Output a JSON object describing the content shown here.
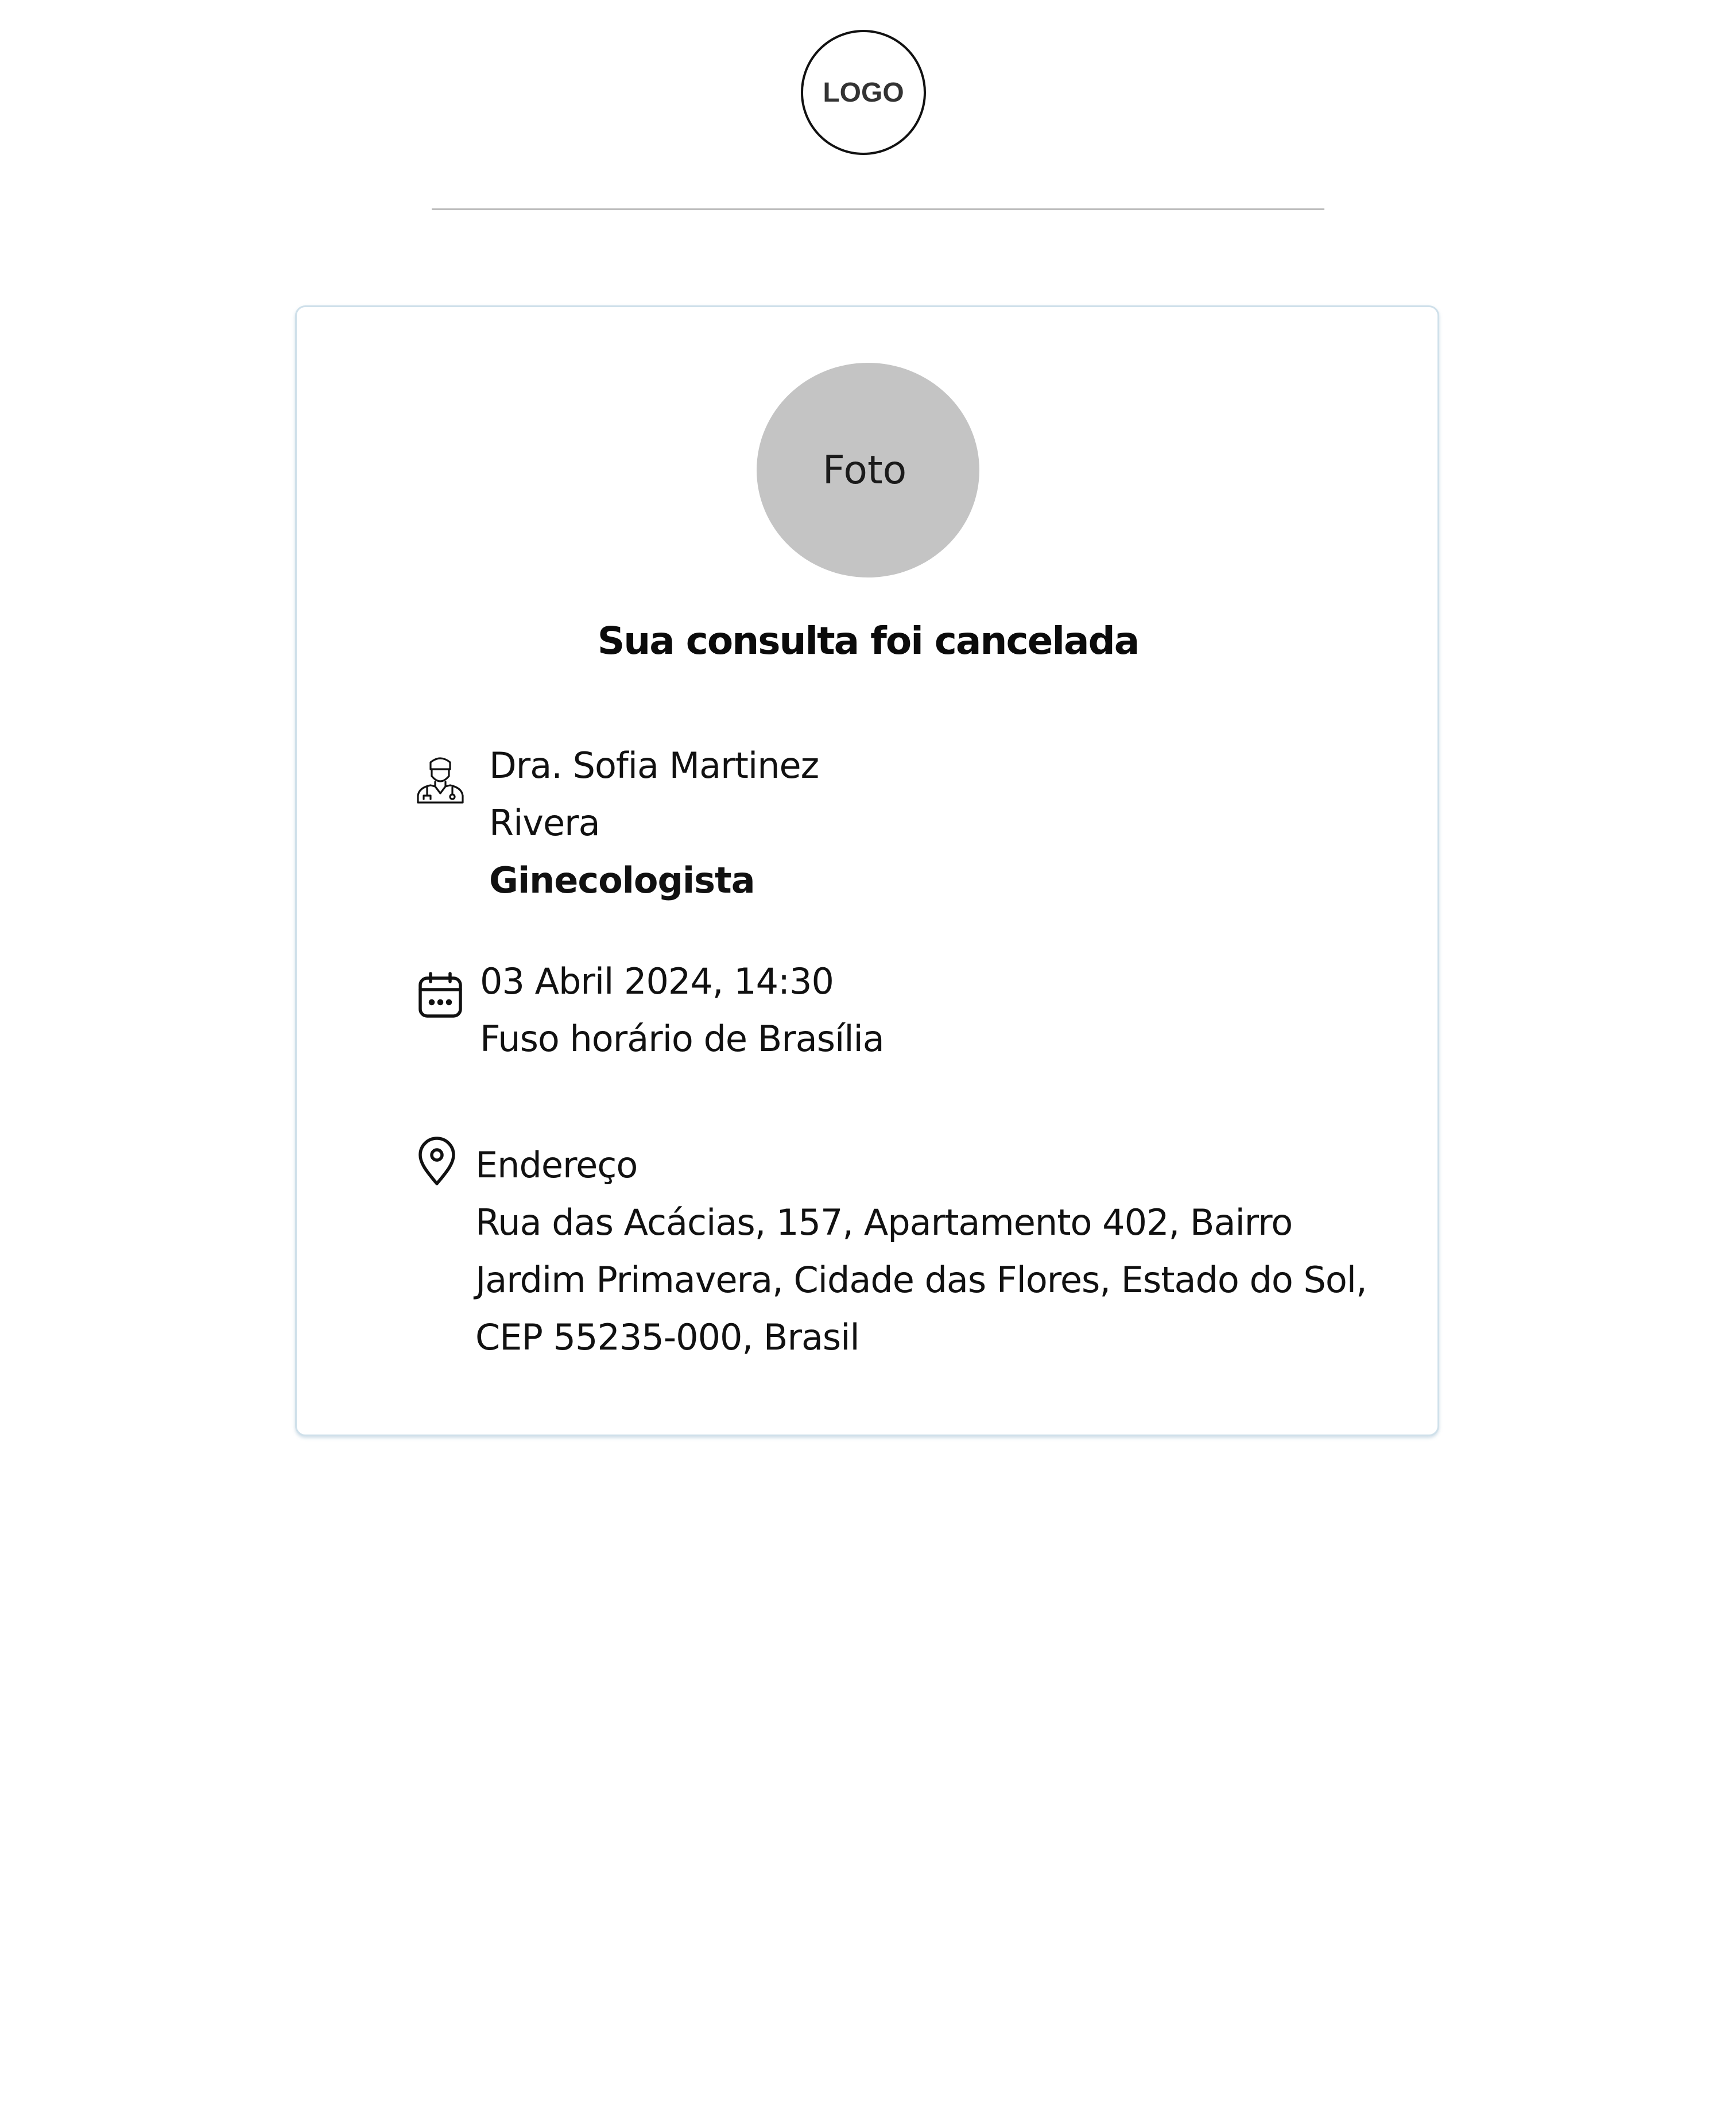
{
  "header": {
    "logo_text": "LOGO"
  },
  "card": {
    "photo_label": "Foto",
    "title": "Sua consulta foi cancelada",
    "doctor": {
      "icon": "doctor-icon",
      "name_line1": "Dra. Sofia Martinez",
      "name_line2": "Rivera",
      "specialty": "Ginecologista"
    },
    "appointment": {
      "icon": "calendar-icon",
      "datetime": "03 Abril 2024, 14:30",
      "timezone": "Fuso horário de Brasília"
    },
    "address": {
      "icon": "location-pin-icon",
      "label": "Endereço",
      "line1": "Rua das Acácias, 157, Apartamento 402, Bairro",
      "line2": "Jardim Primavera, Cidade das Flores, Estado do Sol,",
      "line3": "CEP 55235-000, Brasil"
    }
  },
  "colors": {
    "card_border": "#cfe0ea",
    "photo_placeholder": "#c4c4c4",
    "divider": "#bdbdbd"
  }
}
